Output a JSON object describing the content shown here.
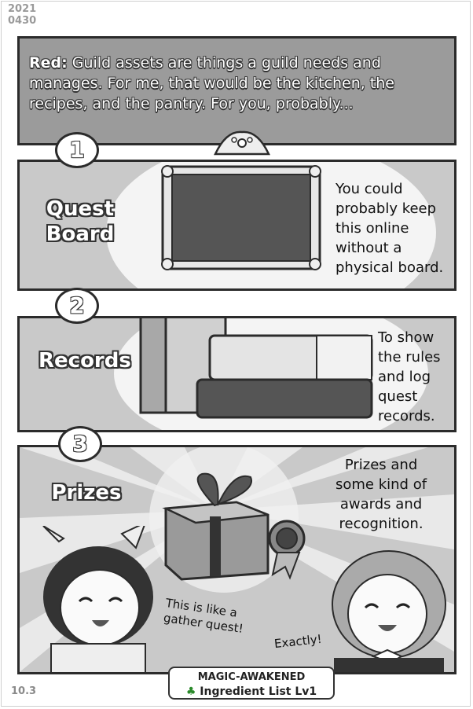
{
  "header": {
    "date_year": "2021",
    "date_day": "0430"
  },
  "intro": {
    "speaker": "Red:",
    "text": "Guild assets are things a guild needs and manages. For me, that would be the kitchen, the recipes, and the pantry. For you, probably..."
  },
  "items": [
    {
      "number": "1",
      "label_line1": "Quest",
      "label_line2": "Board",
      "note": [
        "You could",
        "probably keep",
        "this online",
        "without a",
        "physical board."
      ]
    },
    {
      "number": "2",
      "label_line1": "Records",
      "label_line2": "",
      "note": [
        "To show",
        "the rules",
        "and log",
        "quest",
        "records."
      ]
    },
    {
      "number": "3",
      "label_line1": "Prizes",
      "label_line2": "",
      "note": [
        "Prizes and",
        "some kind of",
        "awards and",
        "recognition."
      ]
    }
  ],
  "dialogue": {
    "left": [
      "This is like a",
      "gather quest!"
    ],
    "right": "Exactly!"
  },
  "badge": {
    "title": "MAGIC-AWAKENED",
    "clover": "♣",
    "subtitle": "Ingredient List Lv1"
  },
  "footer": {
    "page_number": "10.3"
  }
}
